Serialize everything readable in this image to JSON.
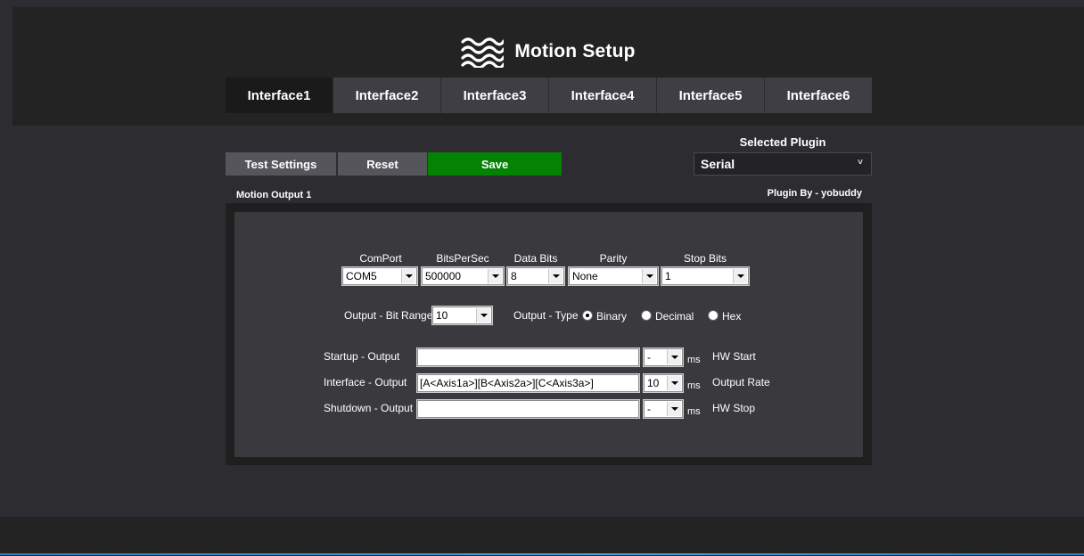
{
  "header": {
    "title": "Motion Setup",
    "logo_icon": "waves-icon"
  },
  "tabs": [
    {
      "label": "Interface1",
      "active": true
    },
    {
      "label": "Interface2",
      "active": false
    },
    {
      "label": "Interface3",
      "active": false
    },
    {
      "label": "Interface4",
      "active": false
    },
    {
      "label": "Interface5",
      "active": false
    },
    {
      "label": "Interface6",
      "active": false
    }
  ],
  "toolbar": {
    "test_label": "Test Settings",
    "reset_label": "Reset",
    "save_label": "Save",
    "save_color": "#038204"
  },
  "plugin": {
    "label": "Selected Plugin",
    "selected": "Serial",
    "chevron": "˅",
    "by": "Plugin By - yobuddy"
  },
  "section": {
    "label": "Motion Output 1"
  },
  "serial": {
    "comport": {
      "label": "ComPort",
      "value": "COM5"
    },
    "bps": {
      "label": "BitsPerSec",
      "value": "500000"
    },
    "databits": {
      "label": "Data Bits",
      "value": "8"
    },
    "parity": {
      "label": "Parity",
      "value": "None"
    },
    "stopbits": {
      "label": "Stop Bits",
      "value": "1"
    }
  },
  "output": {
    "bitrange_label": "Output - Bit Range",
    "bitrange_value": "10",
    "type_label": "Output - Type",
    "types": [
      {
        "label": "Binary",
        "checked": true
      },
      {
        "label": "Decimal",
        "checked": false
      },
      {
        "label": "Hex",
        "checked": false
      }
    ]
  },
  "rows": [
    {
      "label": "Startup - Output",
      "value": "",
      "combo": "-",
      "unit": "ms",
      "right": "HW Start"
    },
    {
      "label": "Interface - Output",
      "value": "[A<Axis1a>][B<Axis2a>][C<Axis3a>]",
      "combo": "10",
      "unit": "ms",
      "right": "Output Rate"
    },
    {
      "label": "Shutdown - Output",
      "value": "",
      "combo": "-",
      "unit": "ms",
      "right": "HW Stop"
    }
  ]
}
